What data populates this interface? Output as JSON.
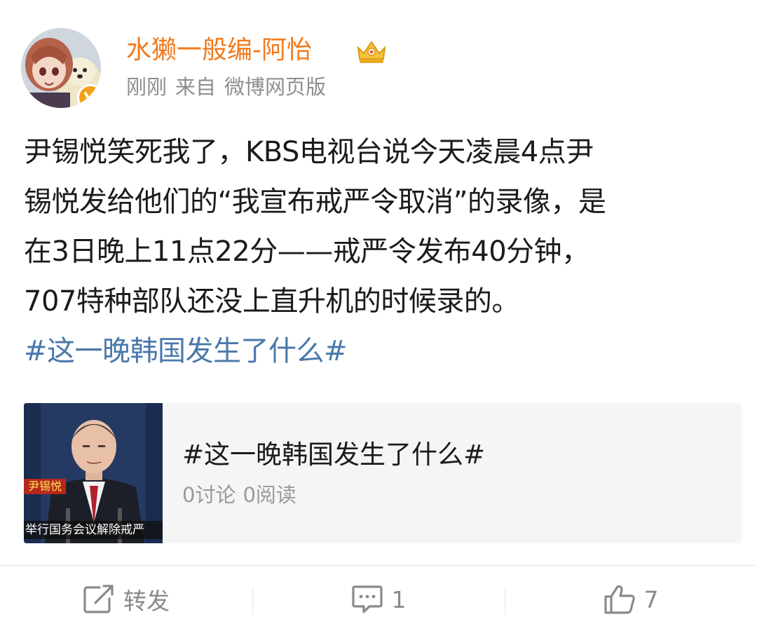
{
  "author": {
    "username": "水獭一般编-阿怡",
    "time": "刚刚",
    "source_prefix": "来自",
    "source": "微博网页版",
    "verified_icon": "verified-v-icon",
    "badge_icon": "crown-badge-icon"
  },
  "post": {
    "lines": [
      "尹锡悦笑死我了，KBS电视台说今天凌晨4点尹",
      "锡悦发给他们的“我宣布戒严令取消”的录像，是",
      "在3日晚上11点22分——戒严令发布40分钟，",
      "707特种部队还没上直升机的时候录的。"
    ],
    "hashtag": "#这一晚韩国发生了什么#"
  },
  "topic_card": {
    "title": "#这一晚韩国发生了什么#",
    "discussions": "0讨论",
    "reads": "0阅读",
    "thumb_tag": "尹锡悦",
    "thumb_caption": "举行国务会议解除戒严"
  },
  "actions": {
    "repost_label": "转发",
    "comment_count": "1",
    "like_count": "7"
  },
  "colors": {
    "username": "#f27a1d",
    "hashtag": "#4a78ac",
    "meta": "#8e8e8e",
    "card_bg": "#f5f5f5"
  }
}
